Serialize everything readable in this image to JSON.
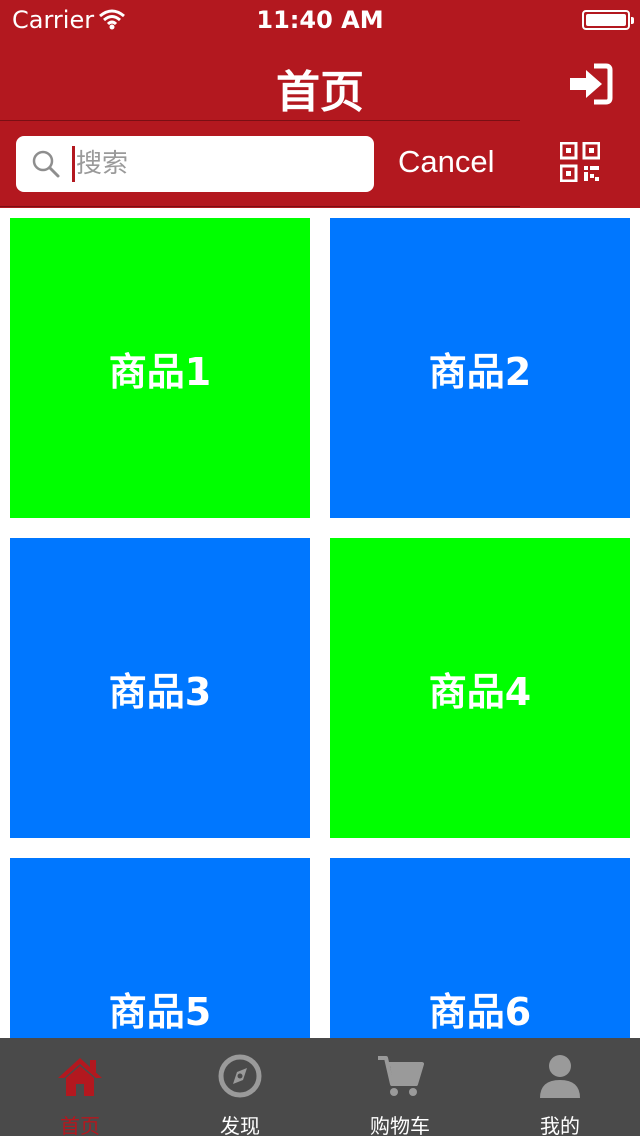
{
  "status_bar": {
    "carrier": "Carrier",
    "time": "11:40 AM"
  },
  "nav": {
    "title": "首页",
    "login_icon": "sign-in-icon"
  },
  "search": {
    "placeholder": "搜索",
    "value": "",
    "cancel_label": "Cancel",
    "qr_icon": "qr-code-icon"
  },
  "products": [
    {
      "label": "商品1",
      "color": "#00ff00"
    },
    {
      "label": "商品2",
      "color": "#0077ff"
    },
    {
      "label": "商品3",
      "color": "#0077ff"
    },
    {
      "label": "商品4",
      "color": "#00ff00"
    },
    {
      "label": "商品5",
      "color": "#0077ff"
    },
    {
      "label": "商品6",
      "color": "#0077ff"
    }
  ],
  "tabbar": {
    "items": [
      {
        "label": "首页",
        "icon": "home-icon",
        "active": true
      },
      {
        "label": "发现",
        "icon": "compass-icon",
        "active": false
      },
      {
        "label": "购物车",
        "icon": "cart-icon",
        "active": false
      },
      {
        "label": "我的",
        "icon": "user-icon",
        "active": false
      }
    ]
  },
  "colors": {
    "brand": "#b3181f",
    "tabbar_bg": "#4a4a4a",
    "tab_inactive": "#9a9a9a"
  }
}
